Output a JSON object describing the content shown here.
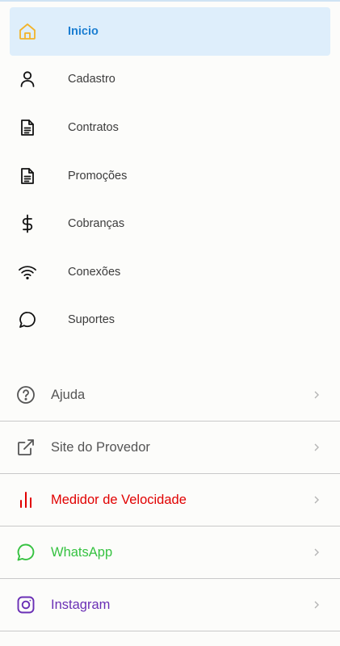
{
  "nav": {
    "items": [
      {
        "label": "Inicio",
        "icon": "home-icon",
        "active": true
      },
      {
        "label": "Cadastro",
        "icon": "user-icon"
      },
      {
        "label": "Contratos",
        "icon": "document-icon"
      },
      {
        "label": "Promoções",
        "icon": "document-icon"
      },
      {
        "label": "Cobranças",
        "icon": "dollar-icon"
      },
      {
        "label": "Conexões",
        "icon": "wifi-icon"
      },
      {
        "label": "Suportes",
        "icon": "chat-bubble-icon"
      }
    ]
  },
  "links": {
    "items": [
      {
        "label": "Ajuda",
        "icon": "help-circle-icon",
        "color": "#555555"
      },
      {
        "label": "Site do Provedor",
        "icon": "external-link-icon",
        "color": "#555555"
      },
      {
        "label": "Medidor de Velocidade",
        "icon": "bar-chart-icon",
        "color": "#e10000"
      },
      {
        "label": "WhatsApp",
        "icon": "whatsapp-icon",
        "color": "#36c241"
      },
      {
        "label": "Instagram",
        "icon": "instagram-icon",
        "color": "#6a2fb5"
      }
    ]
  },
  "colors": {
    "accent": "#1b7ed2",
    "active_bg": "#deeefb",
    "home_icon": "#f2b32a"
  }
}
